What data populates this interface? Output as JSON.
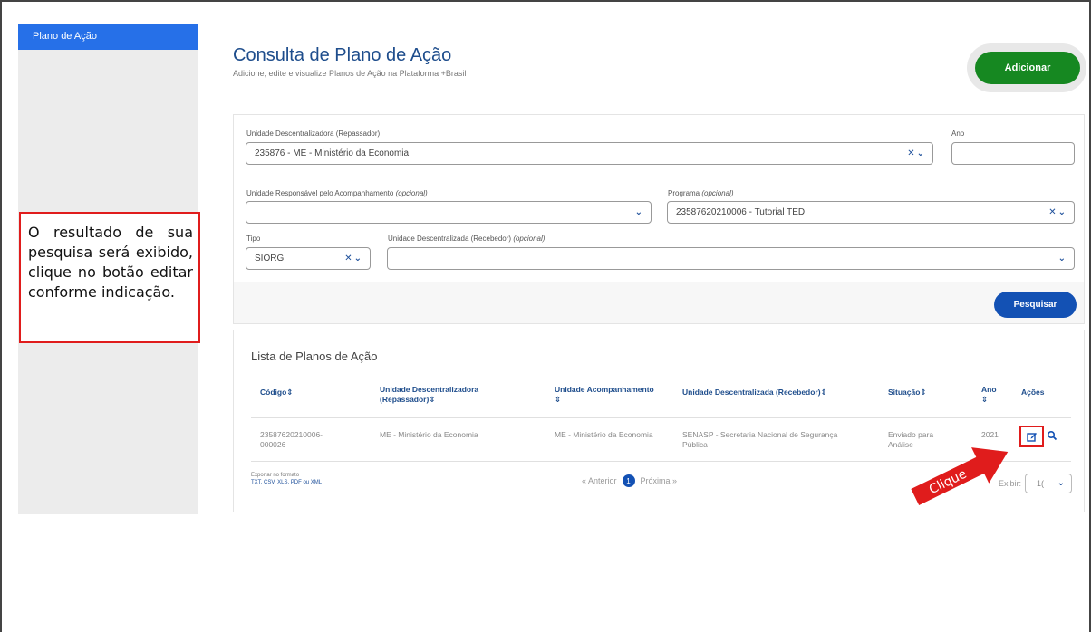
{
  "sidebar": {
    "items": [
      {
        "label": "Plano de Ação"
      }
    ]
  },
  "callout": {
    "text": "O resultado de sua pesquisa será exibido, clique no botão editar conforme indicação."
  },
  "header": {
    "title": "Consulta de Plano de Ação",
    "subtitle": "Adicione, edite e visualize Planos de Ação na Plataforma +Brasil",
    "add_label": "Adicionar"
  },
  "filters": {
    "unidade_descentralizadora": {
      "label": "Unidade Descentralizadora (Repassador)",
      "value": "235876 - ME - Ministério da Economia"
    },
    "ano": {
      "label": "Ano",
      "value": ""
    },
    "unidade_responsavel": {
      "label": "Unidade Responsável pelo Acompanhamento",
      "optional": "(opcional)",
      "value": ""
    },
    "programa": {
      "label": "Programa",
      "optional": "(opcional)",
      "value": "23587620210006 - Tutorial TED"
    },
    "tipo": {
      "label": "Tipo",
      "value": "SIORG"
    },
    "unidade_recebedor": {
      "label": "Unidade Descentralizada (Recebedor)",
      "optional": "(opcional)",
      "value": ""
    },
    "search_label": "Pesquisar"
  },
  "results": {
    "title": "Lista de Planos de Ação",
    "columns": {
      "codigo": "Código⇕",
      "unid_desc_1": "Unidade Descentralizadora",
      "unid_desc_2": "(Repassador)⇕",
      "unid_acomp_1": "Unidade Acompanhamento",
      "unid_acomp_2": "⇕",
      "unid_receb": "Unidade Descentralizada (Recebedor)⇕",
      "situacao": "Situação⇕",
      "ano_1": "Ano",
      "ano_2": "⇕",
      "acoes": "Ações"
    },
    "rows": [
      {
        "codigo_1": "23587620210006-",
        "codigo_2": "000026",
        "unid_desc": "ME - Ministério da Economia",
        "unid_acomp": "ME - Ministério da Economia",
        "unid_receb_1": "SENASP - Secretaria Nacional de Segurança",
        "unid_receb_2": "Pública",
        "situacao_1": "Enviado para",
        "situacao_2": "Análise",
        "ano": "2021"
      }
    ],
    "export_label": "Exportar no formato",
    "export_links": "TXT, CSV, XLS, PDF ou XML",
    "pagination": {
      "prev": "« Anterior",
      "current": "1",
      "next": "Próxima »"
    },
    "show_label": "Exibir:",
    "show_value": "1("
  },
  "annotation": {
    "arrow_label": "Clique"
  },
  "colors": {
    "primary": "#1351b4",
    "success": "#168821",
    "highlight": "#e01c1c",
    "sidebar_active": "#2670e8"
  }
}
